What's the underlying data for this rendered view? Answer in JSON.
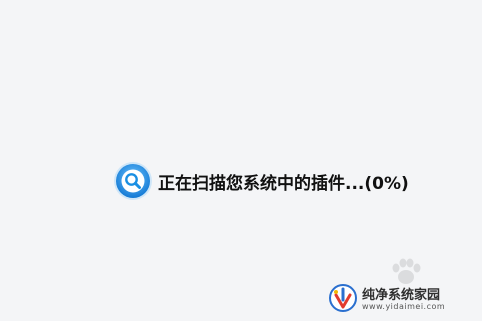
{
  "scan": {
    "status_text": "正在扫描您系统中的插件...(0%)",
    "progress_percent": 0,
    "icon": "search-icon"
  },
  "watermark": {
    "title": "纯净系统家园",
    "url": "www.yidaimei.com",
    "logo_icon": "shield-logo-icon",
    "paw_icon": "paw-icon"
  },
  "colors": {
    "background": "#f4f5f7",
    "icon_blue": "#1a8fe3",
    "text": "#111111"
  }
}
